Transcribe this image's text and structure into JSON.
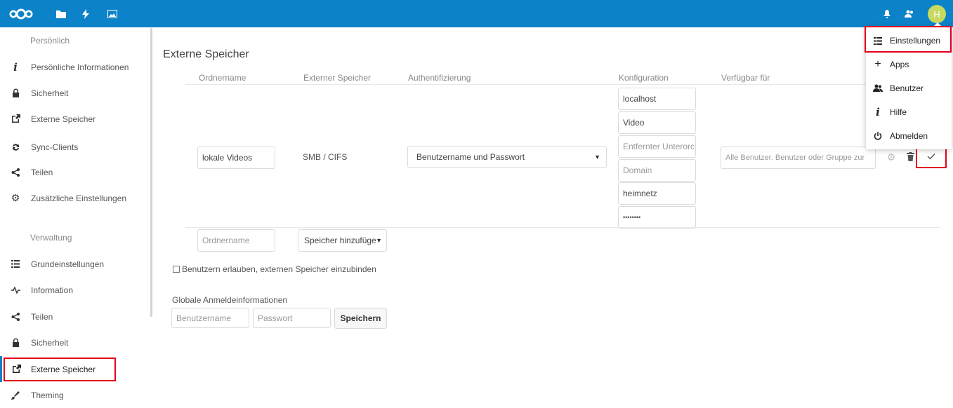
{
  "colors": {
    "header": "#0c82c8",
    "highlight_box": "#e3001b",
    "avatar": "#c7d961"
  },
  "header": {
    "logo_icon": "nextcloud-logo-icon",
    "apps": [
      "files-icon",
      "activity-icon",
      "gallery-icon"
    ],
    "right_icons": [
      "notifications-icon",
      "contacts-icon"
    ],
    "avatar_letter": "H"
  },
  "sidebar": {
    "personal_heading": "Persönlich",
    "personal_items": [
      {
        "label": "Persönliche Informationen",
        "icon": "info-icon"
      },
      {
        "label": "Sicherheit",
        "icon": "lock-icon"
      },
      {
        "label": "Externe Speicher",
        "icon": "external-link-icon"
      },
      {
        "label": "Sync-Clients",
        "icon": "sync-icon"
      },
      {
        "label": "Teilen",
        "icon": "share-icon"
      },
      {
        "label": "Zusätzliche Einstellungen",
        "icon": "gear-icon"
      }
    ],
    "admin_heading": "Verwaltung",
    "admin_items": [
      {
        "label": "Grundeinstellungen",
        "icon": "settings-list-icon"
      },
      {
        "label": "Information",
        "icon": "activity-icon"
      },
      {
        "label": "Teilen",
        "icon": "share-icon"
      },
      {
        "label": "Sicherheit",
        "icon": "lock-icon"
      },
      {
        "label": "Externe Speicher",
        "icon": "external-link-icon",
        "active": true
      },
      {
        "label": "Theming",
        "icon": "theming-icon"
      }
    ]
  },
  "main": {
    "title": "Externe Speicher",
    "columns": [
      "Ordnername",
      "Externer Speicher",
      "Authentifizierung",
      "Konfiguration",
      "Verfügbar für"
    ],
    "mount": {
      "folder_name": "lokale Videos",
      "storage": "SMB / CIFS",
      "auth": "Benutzername und Passwort",
      "config": [
        "localhost",
        "Video",
        "Entfernter Unterorc",
        "Domain",
        "heimnetz",
        "••••••••"
      ],
      "available_placeholder": "Alle Benutzer. Benutzer oder Gruppe zur"
    },
    "new_row": {
      "folder_placeholder": "Ordnername",
      "add_storage_label": "Speicher hinzufüge"
    },
    "allow_users_label": "Benutzern erlauben, externen Speicher einzubinden",
    "global_credentials": {
      "heading": "Globale Anmeldeinformationen",
      "username_placeholder": "Benutzername",
      "password_placeholder": "Passwort",
      "save_label": "Speichern"
    }
  },
  "user_menu": {
    "items": [
      {
        "label": "Einstellungen",
        "icon": "settings-list-icon"
      },
      {
        "label": "Apps",
        "icon": "plus-icon"
      },
      {
        "label": "Benutzer",
        "icon": "users-icon"
      },
      {
        "label": "Hilfe",
        "icon": "info-icon"
      },
      {
        "label": "Abmelden",
        "icon": "power-icon"
      }
    ]
  }
}
